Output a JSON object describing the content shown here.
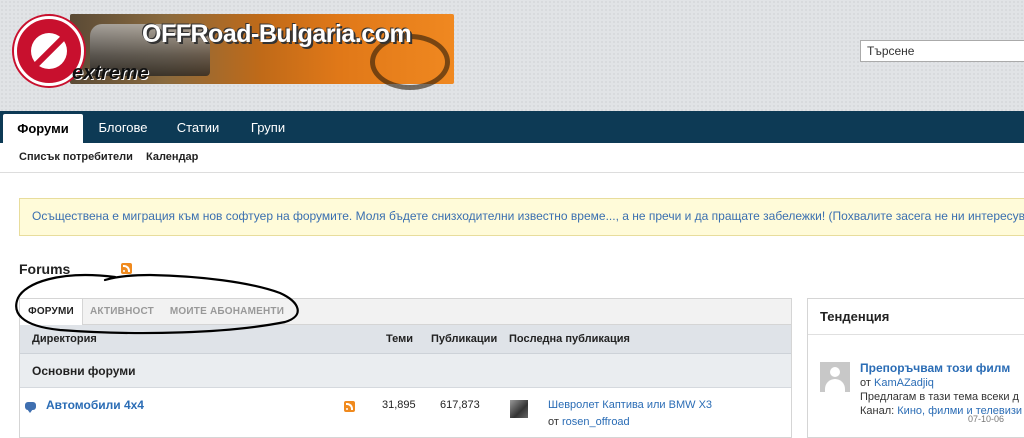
{
  "header": {
    "logo_title": "OFFRoad-Bulgaria.com",
    "logo_sub": "extreme",
    "search_placeholder": "Търсене"
  },
  "nav": {
    "tabs": [
      {
        "label": "Форуми",
        "active": true
      },
      {
        "label": "Блогове",
        "active": false
      },
      {
        "label": "Статии",
        "active": false
      },
      {
        "label": "Групи",
        "active": false
      }
    ],
    "sub": [
      "Списък потребители",
      "Календар"
    ]
  },
  "notice": "Осъществена е миграция към нов софтуер на форумите. Моля бъдете снизходителни известно време..., а не пречи и да пращате забележки! (Похвалите засега не ни интересуват)",
  "forums": {
    "title": "Forums",
    "tabs": [
      "ФОРУМИ",
      "АКТИВНОСТ",
      "МОИТЕ АБОНАМЕНТИ"
    ],
    "columns": [
      "Директория",
      "Теми",
      "Публикации",
      "Последна публикация"
    ],
    "section": "Основни форуми",
    "rows": [
      {
        "name": "Автомобили 4x4",
        "topics": "31,895",
        "posts": "617,873",
        "last_title": "Шевролет Каптива или BMW X3",
        "last_by_prefix": "от",
        "last_by": "rosen_offroad"
      }
    ]
  },
  "trend": {
    "title": "Тенденция",
    "item_title": "Препоръчвам този филм",
    "by_prefix": "от",
    "by": "KamAZadjiq",
    "excerpt": "Предлагам в тази тема всеки д",
    "channel_label": "Канал:",
    "channel": "Кино, филми и телевизи",
    "date": "07-10-06"
  },
  "colors": {
    "nav_bg": "#0d3a55",
    "link": "#2a6cb5",
    "notice_bg": "#fffbd9",
    "rss": "#f08a1e"
  }
}
